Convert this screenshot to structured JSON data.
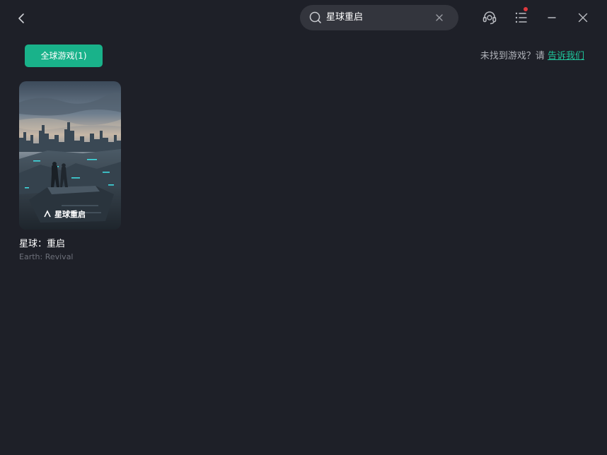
{
  "search": {
    "value": "星球重启",
    "icon": "search-icon"
  },
  "toolbar": {
    "back_icon": "chevron-left-icon",
    "support_icon": "headset-icon",
    "menu_icon": "list-menu-icon",
    "minimize_icon": "minimize-icon",
    "close_icon": "close-icon",
    "notification_color": "#e0393e"
  },
  "filter": {
    "tab_label": "全球游戏(1)",
    "accent": "#19b28a"
  },
  "feedback": {
    "prompt": "未找到游戏？请 ",
    "link": "告诉我们"
  },
  "results": [
    {
      "title": "星球：重启",
      "subtitle": "Earth: Revival",
      "cover_logo": "星球重启"
    }
  ]
}
